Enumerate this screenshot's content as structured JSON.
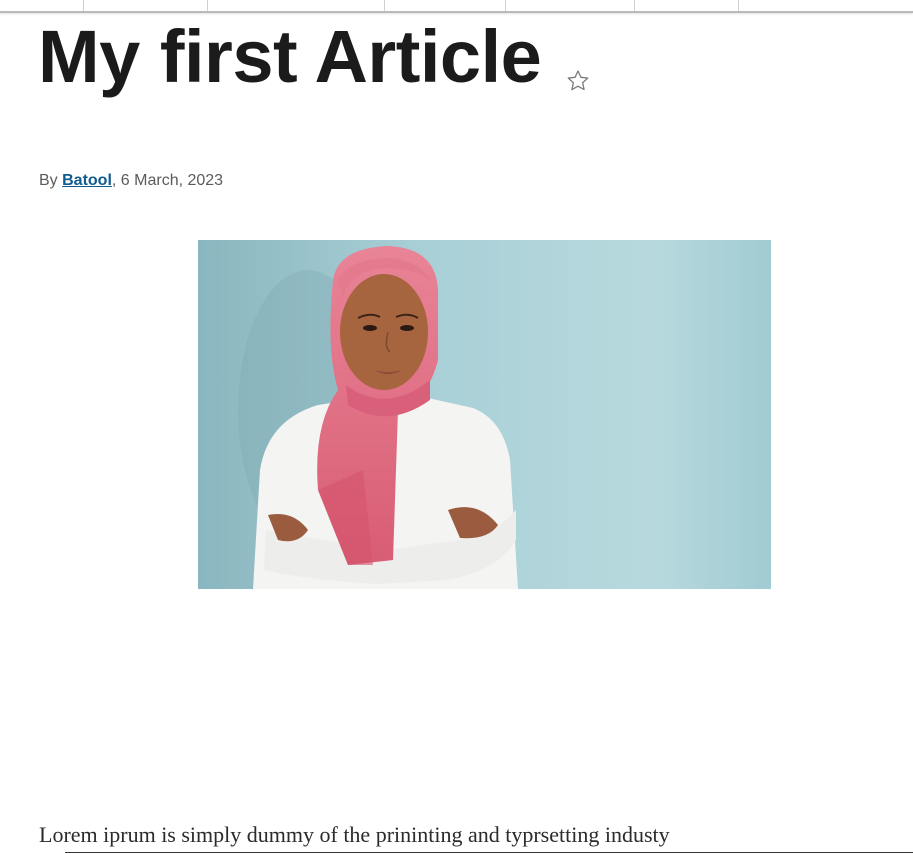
{
  "article": {
    "title": "My first Article",
    "byline_prefix": "By ",
    "author": "Batool",
    "date_separator": ", ",
    "date": "6 March, 2023",
    "image_icon": "photo-woman-pink-hijab",
    "body_first_line": "Lorem iprum is simply dummy of the prininting and typrsetting industy"
  },
  "toolbar": {
    "star_icon": "star-outline-icon"
  },
  "colors": {
    "link": "#0f5c8e",
    "title": "#1b1b1b",
    "meta": "#5b5b5b",
    "image_bg": "#a8d0d7",
    "hijab": "#e06a7e"
  }
}
